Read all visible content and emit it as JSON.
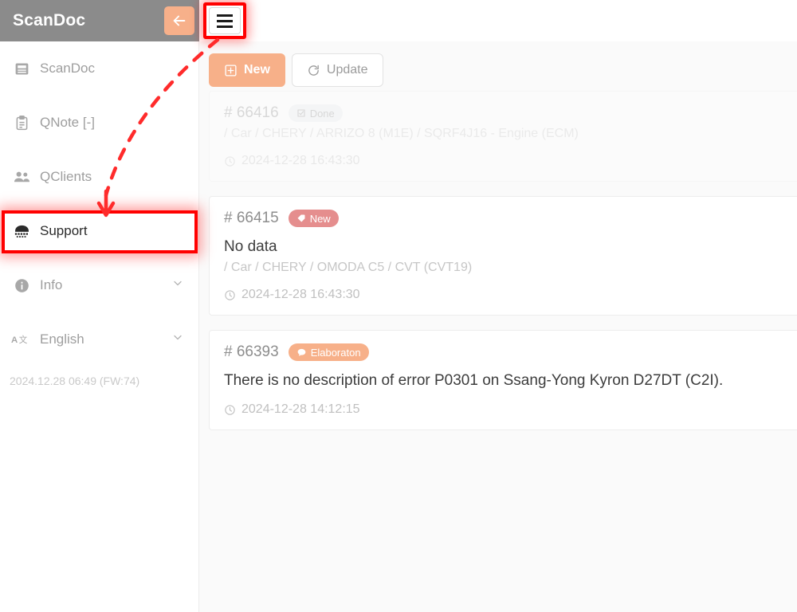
{
  "header": {
    "brand": "ScanDoc",
    "back_label": "back-arrow",
    "menu_label": "hamburger-menu"
  },
  "sidebar": {
    "items": [
      {
        "label": "ScanDoc",
        "icon": "document-icon",
        "chevron": "",
        "active": false
      },
      {
        "label": "QNote [-]",
        "icon": "clipboard-icon",
        "chevron": "",
        "active": false
      },
      {
        "label": "QClients",
        "icon": "users-icon",
        "chevron": "",
        "active": false
      },
      {
        "label": "Support",
        "icon": "telephone-icon",
        "chevron": "",
        "active": true
      },
      {
        "label": "Info",
        "icon": "info-icon",
        "chevron": "⌄",
        "active": false
      },
      {
        "label": "English",
        "icon": "language-icon",
        "chevron": "⌄",
        "active": false
      }
    ],
    "firmware_stamp": "2024.12.28 06:49 (FW:74)"
  },
  "toolbar": {
    "new_label": "New",
    "update_label": "Update"
  },
  "tickets": [
    {
      "id": "# 66416",
      "badge": "Done",
      "badge_type": "done",
      "badge_icon": "check-square-icon",
      "title": "",
      "path": "/ Car / CHERY / ARRIZO 8 (M1E) / SQRF4J16 - Engine (ECM)",
      "time": "2024-12-28 16:43:30",
      "dim": true
    },
    {
      "id": "# 66415",
      "badge": "New",
      "badge_type": "new",
      "badge_icon": "tag-icon",
      "title": "No data",
      "path": "/ Car / CHERY / OMODA C5 / CVT (CVT19)",
      "time": "2024-12-28 16:43:30",
      "dim": false
    },
    {
      "id": "# 66393",
      "badge": "Elaboraton",
      "badge_type": "elab",
      "badge_icon": "comment-icon",
      "title": "There is no description of error P0301 on Ssang-Yong Kyron D27DT (C2I).",
      "path": "",
      "time": "2024-12-28 14:12:15",
      "dim": false
    }
  ],
  "annotation": {
    "highlight_color": "#ff0000",
    "arrow_color": "#ff2b2b",
    "cursor": "hand-pointer-cursor"
  },
  "colors": {
    "accent": "#f7b089",
    "header_gray": "#8b8b8b",
    "new_badge": "#e58e8e",
    "main_bg": "#fafafa"
  }
}
